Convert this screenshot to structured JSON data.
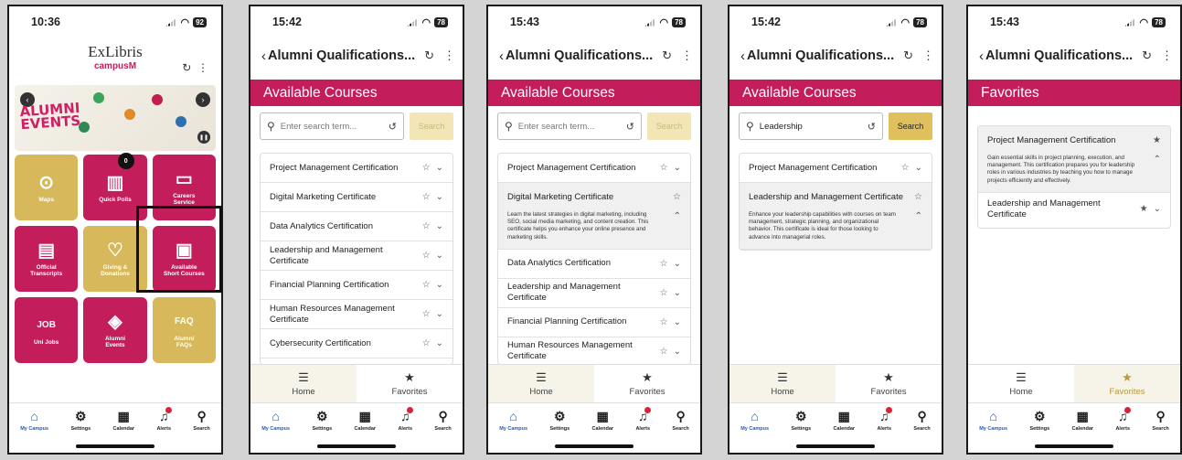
{
  "phone1": {
    "time": "10:36",
    "battery": "92",
    "logo_top": "ExLibris",
    "logo_bottom": "campusM",
    "hero_text_1": "ALUMNI",
    "hero_text_2": "EVENTS",
    "tiles": [
      {
        "label": "Maps",
        "icon": "map-pin-icon",
        "glyph": "⊙",
        "color": "gold"
      },
      {
        "label": "Quick Polls",
        "icon": "bar-chart-icon",
        "glyph": "▥",
        "color": "pink",
        "badge": "0"
      },
      {
        "label": "Careers\nService",
        "icon": "career-board-icon",
        "glyph": "▭",
        "color": "pink"
      },
      {
        "label": "Official\nTranscripts",
        "icon": "certificate-icon",
        "glyph": "▤",
        "color": "pink"
      },
      {
        "label": "Giving &\nDonations",
        "icon": "gift-hands-icon",
        "glyph": "♡",
        "color": "gold"
      },
      {
        "label": "Available\nShort Courses",
        "icon": "laptop-icon",
        "glyph": "▣",
        "color": "pink"
      },
      {
        "label": "Uni Jobs",
        "icon": "job-sign-icon",
        "glyph": "JOB",
        "color": "pink"
      },
      {
        "label": "Alumni\nEvents",
        "icon": "alumni-events-icon",
        "glyph": "◈",
        "color": "pink"
      },
      {
        "label": "Alumni\nFAQs",
        "icon": "faq-bubble-icon",
        "glyph": "FAQ",
        "color": "gold"
      }
    ]
  },
  "dock": [
    "My Campus",
    "Settings",
    "Calendar",
    "Alerts",
    "Search"
  ],
  "app_title": "Alumni Qualifications...",
  "available_courses": "Available Courses",
  "favorites_title": "Favorites",
  "search_placeholder": "Enter search term...",
  "search_button": "Search",
  "tab_home": "Home",
  "tab_favorites": "Favorites",
  "phone2": {
    "time": "15:42",
    "battery": "78",
    "courses": [
      "Project Management Certification",
      "Digital Marketing Certificate",
      "Data Analytics Certification",
      "Leadership and Management Certificate",
      "Financial Planning Certification",
      "Human Resources Management Certificate",
      "Cybersecurity Certification"
    ]
  },
  "phone3": {
    "time": "15:43",
    "battery": "78",
    "expanded_desc": "Learn the latest strategies in digital marketing, including SEO, social media marketing, and content creation. This certificate helps you enhance your online presence and marketing skills.",
    "courses": [
      "Project Management Certification",
      "Digital Marketing Certificate",
      "Data Analytics Certification",
      "Leadership and Management Certificate",
      "Financial Planning Certification",
      "Human Resources Management Certificate"
    ]
  },
  "phone4": {
    "time": "15:42",
    "battery": "78",
    "search_value": "Leadership",
    "courses": [
      "Project Management Certification",
      "Leadership and Management Certificate"
    ],
    "expanded_desc": "Enhance your leadership capabilities with courses on team management, strategic planning, and organizational behavior. This certificate is ideal for those looking to advance into managerial roles."
  },
  "phone5": {
    "time": "15:43",
    "battery": "78",
    "fav1": "Project Management Certification",
    "fav1_desc": "Gain essential skills in project planning, execution, and management. This certification prepares you for leadership roles in various industries by teaching you how to manage projects efficiently and effectively.",
    "fav2": "Leadership and Management Certificate"
  }
}
